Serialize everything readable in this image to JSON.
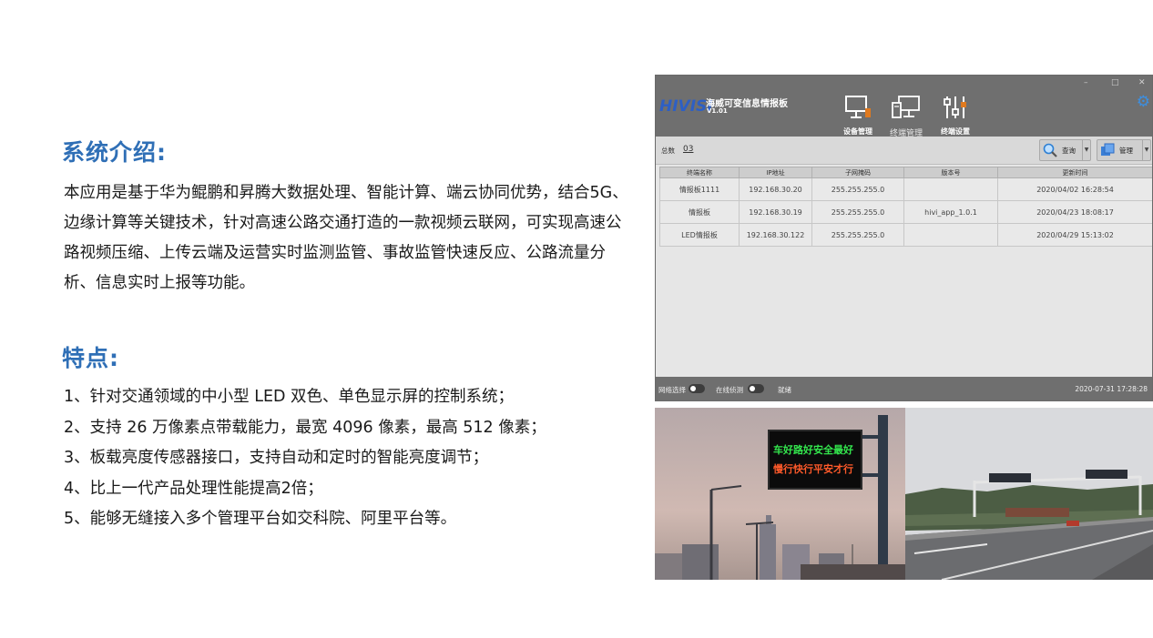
{
  "intro": {
    "heading": "系统介绍:",
    "body": "本应用是基于华为鲲鹏和昇腾大数据处理、智能计算、端云协同优势，结合5G、边缘计算等关键技术，针对高速公路交通打造的一款视频云联网，可实现高速公路视频压缩、上传云端及运营实时监测监管、事故监管快速反应、公路流量分析、信息实时上报等功能。"
  },
  "features": {
    "heading": "特点:",
    "items": [
      "1、针对交通领域的中小型 LED 双色、单色显示屏的控制系统；",
      "2、支持 26 万像素点带载能力，最宽 4096 像素，最高 512 像素；",
      "3、板载亮度传感器接口，支持自动和定时的智能亮度调节；",
      "4、比上一代产品处理性能提高2倍；",
      "5、能够无缝接入多个管理平台如交科院、阿里平台等。"
    ]
  },
  "app": {
    "logo": "HIVISI",
    "title": "海威可变信息情报板",
    "version": "V1.01",
    "window_controls": [
      "–",
      "□",
      "✕"
    ],
    "nav": [
      {
        "label": "设备管理",
        "icon": "monitor-icon"
      },
      {
        "label": "终端管理",
        "icon": "terminal-icon"
      },
      {
        "label": "终端设置",
        "icon": "settings-sliders-icon"
      }
    ],
    "toolbar": {
      "total_label": "总数",
      "total_value": "03",
      "query_label": "查询",
      "manage_label": "管理"
    },
    "table": {
      "columns": [
        "终端名称",
        "IP地址",
        "子网掩码",
        "版本号",
        "更新时间"
      ],
      "rows": [
        [
          "情报板1111",
          "192.168.30.20",
          "255.255.255.0",
          "",
          "2020/04/02 16:28:54"
        ],
        [
          "情报板",
          "192.168.30.19",
          "255.255.255.0",
          "hivi_app_1.0.1",
          "2020/04/23 18:08:17"
        ],
        [
          "LED情报板",
          "192.168.30.122",
          "255.255.255.0",
          "",
          "2020/04/29 15:13:02"
        ]
      ]
    },
    "status": {
      "network_label": "网络选择",
      "online_label": "在线侦测",
      "state": "就绪",
      "datetime": "2020-07-31 17:28:28"
    },
    "colors": {
      "titlebar": "#6f6f6f",
      "accent": "#3d8fe0",
      "heading": "#2f6fb6"
    }
  },
  "photos": {
    "led_line_1": "车好路好安全最好",
    "led_line_2": "慢行快行平安才行"
  }
}
